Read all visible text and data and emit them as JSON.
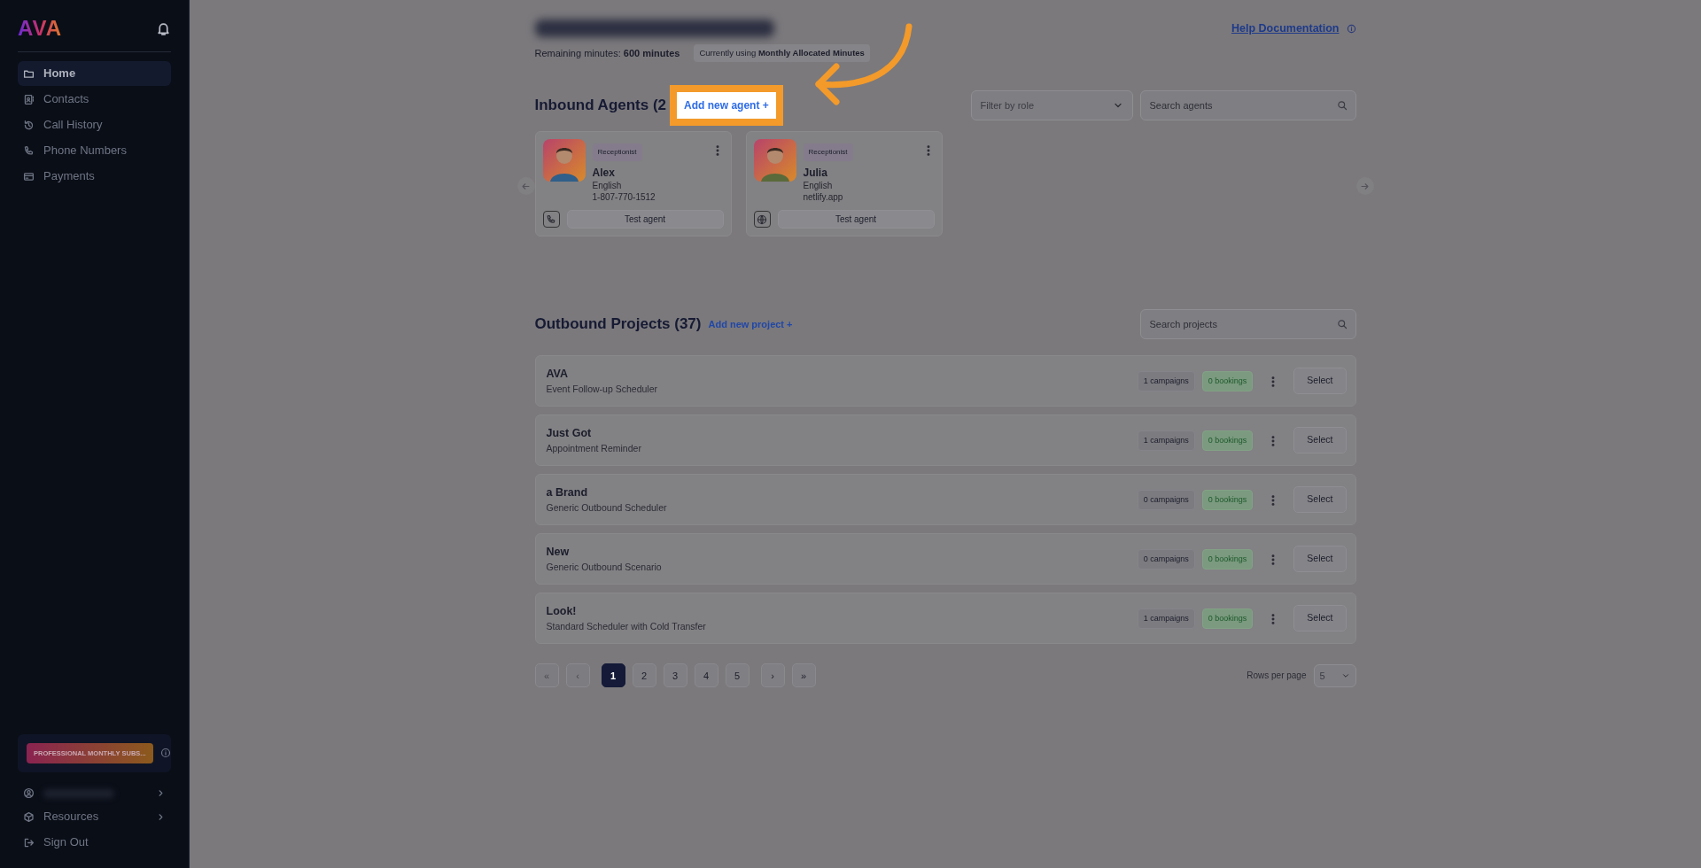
{
  "sidebar": {
    "logo": "AVA",
    "nav": [
      {
        "label": "Home",
        "selected": true
      },
      {
        "label": "Contacts",
        "selected": false
      },
      {
        "label": "Call History",
        "selected": false
      },
      {
        "label": "Phone Numbers",
        "selected": false
      },
      {
        "label": "Payments",
        "selected": false
      }
    ],
    "plan": "PROFESSIONAL MONTHLY SUBS...",
    "bottom": [
      {
        "kind": "account"
      },
      {
        "kind": "resources",
        "label": "Resources"
      },
      {
        "kind": "signout",
        "label": "Sign Out"
      }
    ]
  },
  "header": {
    "help_link": "Help Documentation",
    "remaining": "Remaining minutes: **600 minutes**",
    "usage": "Currently using **Monthly Allocated Minutes**"
  },
  "inbound": {
    "title": "Inbound Agents (2",
    "add_button": "Add new agent +",
    "filter": "Filter by role",
    "search_placeholder": "Search agents",
    "agents": [
      {
        "role": "Receptionist",
        "name": "Alex",
        "language": "English",
        "contact": "1-807-770-1512",
        "kind": "phone",
        "test_button": "Test agent"
      },
      {
        "role": "Receptionist",
        "name": "Julia",
        "language": "English",
        "contact": "netlify.app",
        "kind": "web",
        "test_button": "Test agent"
      }
    ]
  },
  "outbound": {
    "title": "Outbound Projects (37)",
    "add_button": "Add new project +",
    "search_placeholder": "Search projects",
    "projects": [
      {
        "name": "AVA",
        "scenario": "Event Follow-up Scheduler",
        "campaigns": "1 campaigns",
        "bookings": "0 bookings",
        "action": "Select"
      },
      {
        "name": "Just Got",
        "scenario": "Appointment Reminder",
        "campaigns": "1 campaigns",
        "bookings": "0 bookings",
        "action": "Select"
      },
      {
        "name": "a Brand",
        "scenario": "Generic Outbound Scheduler",
        "campaigns": "0 campaigns",
        "bookings": "0 bookings",
        "action": "Select"
      },
      {
        "name": "New",
        "scenario": "Generic Outbound Scenario",
        "campaigns": "0 campaigns",
        "bookings": "0 bookings",
        "action": "Select"
      },
      {
        "name": "Look!",
        "scenario": "Standard Scheduler with Cold Transfer",
        "campaigns": "1 campaigns",
        "bookings": "0 bookings",
        "action": "Select"
      }
    ],
    "pagination": [
      {
        "label": "«",
        "selected": false,
        "disabled": true
      },
      {
        "label": "‹",
        "selected": false,
        "disabled": true
      },
      {
        "label": "1",
        "selected": true,
        "disabled": false
      },
      {
        "label": "2",
        "selected": false,
        "disabled": false
      },
      {
        "label": "3",
        "selected": false,
        "disabled": false
      },
      {
        "label": "4",
        "selected": false,
        "disabled": false
      },
      {
        "label": "5",
        "selected": false,
        "disabled": false
      },
      {
        "label": "›",
        "selected": false,
        "disabled": false
      },
      {
        "label": "»",
        "selected": false,
        "disabled": false
      }
    ],
    "rows_per_page_label": "Rows per page",
    "rows_per_page": "5"
  }
}
